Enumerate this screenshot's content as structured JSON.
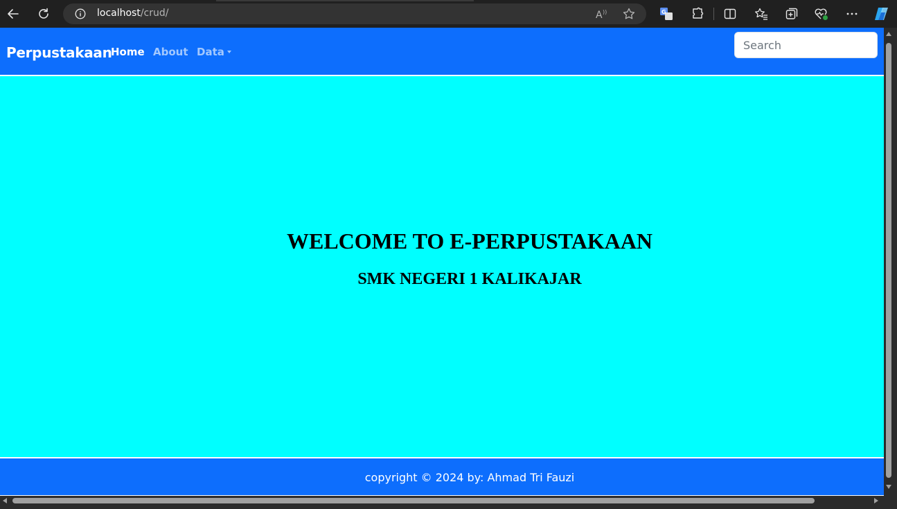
{
  "browser": {
    "url_host": "localhost",
    "url_path": "/crud/",
    "icons": [
      "back-icon",
      "refresh-icon",
      "site-info-icon",
      "read-aloud-icon",
      "favorite-star-icon",
      "translate-icon",
      "extensions-icon",
      "split-screen-icon",
      "favorites-icon",
      "collections-icon",
      "browser-essentials-icon",
      "more-options-icon",
      "copilot-icon"
    ]
  },
  "navbar": {
    "brand": "Perpustakaan",
    "links": [
      "Home",
      "About",
      "Data"
    ],
    "search_placeholder": "Search",
    "color": "#0d6efd"
  },
  "hero": {
    "title": "WELCOME TO E-PERPUSTAKAAN",
    "subtitle": "SMK NEGERI 1 KALIKAJAR",
    "background": "#00ffff"
  },
  "footer": {
    "text": "copyright © 2024 by: Ahmad Tri Fauzi"
  }
}
